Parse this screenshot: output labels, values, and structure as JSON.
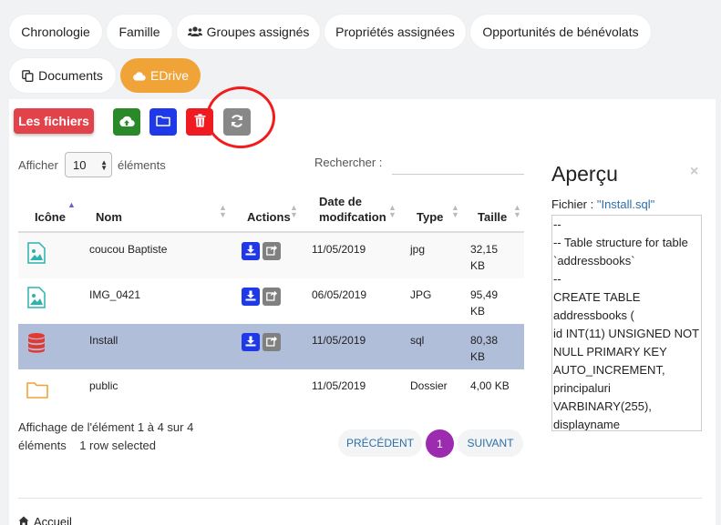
{
  "tabs": [
    {
      "label": "Chronologie",
      "icon": ""
    },
    {
      "label": "Famille",
      "icon": ""
    },
    {
      "label": "Groupes assignés",
      "icon": "users-icon"
    },
    {
      "label": "Propriétés assignées",
      "icon": ""
    },
    {
      "label": "Opportunités de bénévolats",
      "icon": ""
    },
    {
      "label": "Documents",
      "icon": "copy-icon"
    },
    {
      "label": "EDrive",
      "icon": "cloud-icon",
      "active": true
    }
  ],
  "toolbar": {
    "files_label": "Les fichiers",
    "upload_icon": "cloud-upload-icon",
    "folder_icon": "folder-icon",
    "delete_icon": "trash-icon",
    "refresh_icon": "refresh-icon"
  },
  "list_controls": {
    "show_prefix": "Afficher",
    "page_size": "10",
    "show_suffix": "éléments",
    "search_label": "Rechercher :",
    "search_value": ""
  },
  "table": {
    "columns": [
      "Icône",
      "Nom",
      "Actions",
      "Date de modifcation",
      "Type",
      "Taille"
    ],
    "rows": [
      {
        "icon": "image-file-icon",
        "name": "coucou Baptiste",
        "date": "11/05/2019",
        "type": "jpg",
        "size": "32,15 KB"
      },
      {
        "icon": "image-file-icon",
        "name": "IMG_0421",
        "date": "06/05/2019",
        "type": "JPG",
        "size": "95,49 KB"
      },
      {
        "icon": "database-icon",
        "name": "Install",
        "date": "11/05/2019",
        "type": "sql",
        "size": "80,38 KB",
        "selected": true
      },
      {
        "icon": "folder-icon",
        "name": "public",
        "date": "11/05/2019",
        "type": "Dossier",
        "size": "4,00 KB"
      }
    ]
  },
  "table_info": {
    "line1": "Affichage de l'élément 1 à 4 sur 4",
    "line2": "éléments    1 row selected"
  },
  "pagination": {
    "prev": "PRÉCÉDENT",
    "current": "1",
    "next": "SUIVANT"
  },
  "preview": {
    "title": "Aperçu",
    "close": "×",
    "file_label": "Fichier : ",
    "file_value": "\"Install.sql\"",
    "content": "--\n-- Table structure for table `addressbooks`\n--\nCREATE TABLE addressbooks (\nid INT(11) UNSIGNED NOT NULL PRIMARY KEY AUTO_INCREMENT,\nprincipaluri VARBINARY(255),\ndisplayname"
  },
  "footer": {
    "link": "Accueil"
  },
  "colors": {
    "edrive": "#f0a437",
    "files_red": "#e2434b",
    "upload_green": "#2a8a2a",
    "folder_blue": "#1f39e8",
    "delete_red": "#f01a22",
    "refresh_gray": "#888888",
    "selected_row": "#b0bed9",
    "page_current": "#9c2bb0"
  }
}
